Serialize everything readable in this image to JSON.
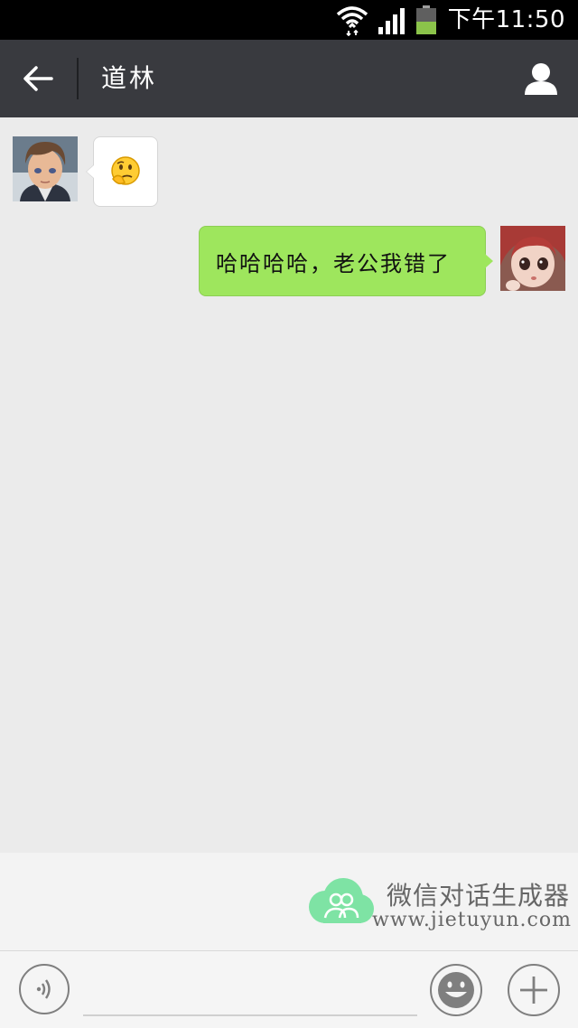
{
  "status_bar": {
    "time": "下午11:50",
    "icons": [
      "wifi-icon",
      "signal-icon",
      "battery-icon"
    ],
    "battery_color": "#8bc34a"
  },
  "header": {
    "title": "道林",
    "back_icon": "arrow-left-icon",
    "profile_icon": "person-icon",
    "background": "#393a3f"
  },
  "messages": [
    {
      "side": "left",
      "type": "emoji",
      "emoji_icon": "thinking-face-emoji",
      "avatar": "male-cartoon-avatar"
    },
    {
      "side": "right",
      "type": "text",
      "text": "哈哈哈哈，老公我错了",
      "avatar": "female-doll-avatar"
    }
  ],
  "watermark": {
    "title": "微信对话生成器",
    "url": "www.jietuyun.com",
    "cloud_color": "#7ee3a4"
  },
  "input_bar": {
    "voice_icon": "voice-icon",
    "emoji_icon": "smiley-icon",
    "plus_icon": "plus-icon",
    "input_value": ""
  },
  "colors": {
    "chat_background": "#ebebeb",
    "sent_bubble": "#9ee65d",
    "received_bubble": "#ffffff"
  }
}
